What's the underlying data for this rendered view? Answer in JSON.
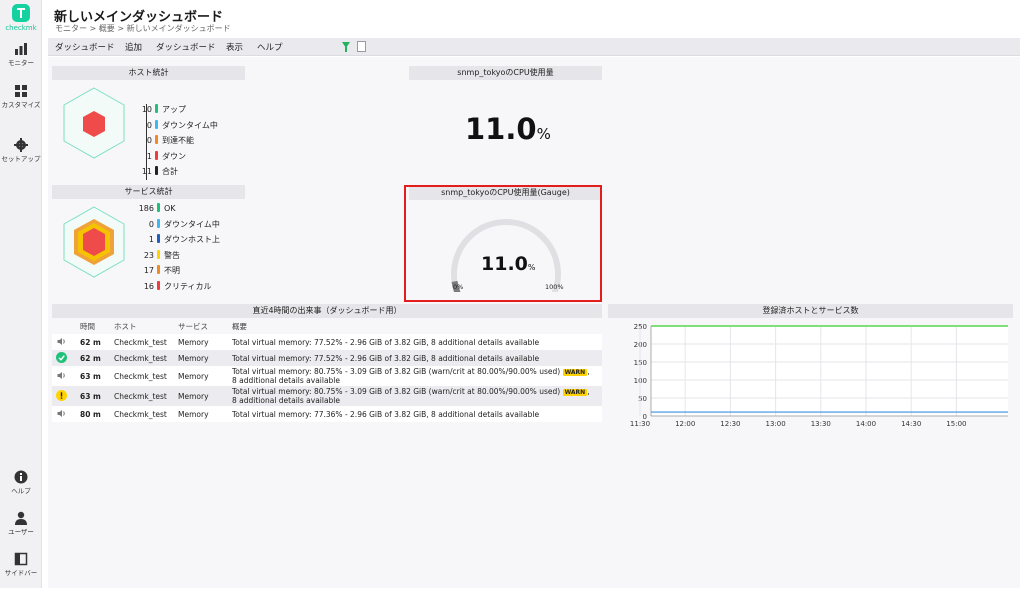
{
  "app": {
    "logo_text": "checkmk"
  },
  "sidebar": {
    "items": [
      {
        "label": "モニター",
        "icon": "bar-chart-icon"
      },
      {
        "label": "カスタマイズ",
        "icon": "grid-icon"
      },
      {
        "label": "セットアップ",
        "icon": "gear-icon"
      },
      {
        "label": "ヘルプ",
        "icon": "info-icon"
      },
      {
        "label": "ユーザー",
        "icon": "user-icon"
      },
      {
        "label": "サイドバー",
        "icon": "sidebar-icon"
      }
    ]
  },
  "header": {
    "title": "新しいメインダッシュボード",
    "breadcrumb": "モニター > 概要 > 新しいメインダッシュボード"
  },
  "menu": {
    "items": [
      "ダッシュボード",
      "追加",
      "ダッシュボード",
      "表示",
      "ヘルプ"
    ],
    "filter_icon": "filter-icon",
    "doc_icon": "document-icon"
  },
  "host_stats": {
    "title": "ホスト統計",
    "rows": [
      {
        "count": "10",
        "label": "アップ",
        "color": "#21c07a"
      },
      {
        "count": "0",
        "label": "ダウンタイム中",
        "color": "#3fb6f0"
      },
      {
        "count": "0",
        "label": "到達不能",
        "color": "#f08a24"
      },
      {
        "count": "1",
        "label": "ダウン",
        "color": "#ee3b3b"
      },
      {
        "count": "11",
        "label": "合計",
        "color": "#222222"
      }
    ]
  },
  "service_stats": {
    "title": "サービス統計",
    "rows": [
      {
        "count": "186",
        "label": "OK",
        "color": "#21c07a"
      },
      {
        "count": "0",
        "label": "ダウンタイム中",
        "color": "#3fb6f0"
      },
      {
        "count": "1",
        "label": "ダウンホスト上",
        "color": "#1f5fbf"
      },
      {
        "count": "23",
        "label": "警告",
        "color": "#ffd200"
      },
      {
        "count": "17",
        "label": "不明",
        "color": "#f08a24"
      },
      {
        "count": "16",
        "label": "クリティカル",
        "color": "#ee3b3b"
      }
    ]
  },
  "cpu_single": {
    "title": "snmp_tokyoのCPU使用量",
    "value": "11.0",
    "unit": "%"
  },
  "cpu_gauge": {
    "title": "snmp_tokyoのCPU使用量(Gauge)",
    "value": "11.0",
    "unit": "%",
    "min_label": "0%",
    "max_label": "100%",
    "fraction": 0.11
  },
  "events": {
    "title": "直近4時間の出来事（ダッシュボード用）",
    "columns": [
      "時間",
      "ホスト",
      "サービス",
      "概要"
    ],
    "rows": [
      {
        "icon": "speaker-icon",
        "time": "62 m",
        "host": "Checkmk_test",
        "service": "Memory",
        "summary": "Total virtual memory: 77.52% - 2.96 GiB of 3.82 GiB, 8 additional details available",
        "warn": "",
        "summary2": ""
      },
      {
        "icon": "ok-check-icon",
        "time": "62 m",
        "host": "Checkmk_test",
        "service": "Memory",
        "summary": "Total virtual memory: 77.52% - 2.96 GiB of 3.82 GiB, 8 additional details available",
        "warn": "",
        "summary2": ""
      },
      {
        "icon": "speaker-icon",
        "time": "63 m",
        "host": "Checkmk_test",
        "service": "Memory",
        "summary": "Total virtual memory: 80.75% - 3.09 GiB of 3.82 GiB (warn/crit at 80.00%/90.00% used)",
        "warn": "WARN",
        "summary2": "8 additional details available"
      },
      {
        "icon": "warning-icon",
        "time": "63 m",
        "host": "Checkmk_test",
        "service": "Memory",
        "summary": "Total virtual memory: 80.75% - 3.09 GiB of 3.82 GiB (warn/crit at 80.00%/90.00% used)",
        "warn": "WARN",
        "summary2": "8 additional details available"
      },
      {
        "icon": "speaker-icon",
        "time": "80 m",
        "host": "Checkmk_test",
        "service": "Memory",
        "summary": "Total virtual memory: 77.36% - 2.96 GiB of 3.82 GiB, 8 additional details available",
        "warn": "",
        "summary2": ""
      }
    ]
  },
  "chart_data": {
    "type": "line",
    "title": "登録済ホストとサービス数",
    "x": [
      "11:30",
      "12:00",
      "12:30",
      "13:00",
      "13:30",
      "14:00",
      "14:30",
      "15:00"
    ],
    "ylim": [
      0,
      250
    ],
    "yticks": [
      "250",
      "200",
      "150",
      "100",
      "50",
      "0"
    ],
    "series": [
      {
        "values": [
          250,
          250,
          250,
          250,
          250,
          250,
          250,
          250
        ],
        "color": "#7fe07a"
      },
      {
        "values": [
          11,
          11,
          11,
          11,
          11,
          11,
          11,
          11
        ],
        "color": "#3b8fe0"
      }
    ]
  }
}
